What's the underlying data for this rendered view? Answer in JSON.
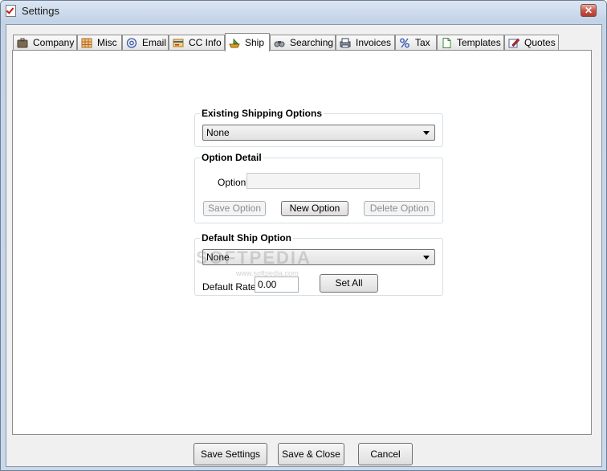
{
  "window": {
    "title": "Settings"
  },
  "tabs": [
    {
      "label": "Company",
      "icon": "briefcase-icon"
    },
    {
      "label": "Misc",
      "icon": "grid-icon"
    },
    {
      "label": "Email",
      "icon": "at-sign-icon"
    },
    {
      "label": "CC Info",
      "icon": "credit-card-icon"
    },
    {
      "label": "Ship",
      "icon": "ship-icon",
      "active": true
    },
    {
      "label": "Searching",
      "icon": "binoculars-icon"
    },
    {
      "label": "Invoices",
      "icon": "printer-icon"
    },
    {
      "label": "Tax",
      "icon": "percent-icon"
    },
    {
      "label": "Templates",
      "icon": "document-icon"
    },
    {
      "label": "Quotes",
      "icon": "note-pencil-icon"
    }
  ],
  "existing": {
    "title": "Existing Shipping Options",
    "selected": "None"
  },
  "detail": {
    "title": "Option Detail",
    "option_label": "Option",
    "option_value": "",
    "save_label": "Save Option",
    "new_label": "New Option",
    "delete_label": "Delete Option"
  },
  "default_ship": {
    "title": "Default Ship Option",
    "selected": "None",
    "rate_label": "Default Rate",
    "rate_value": "0.00",
    "set_all_label": "Set All"
  },
  "watermark": {
    "text": "SOFTPEDIA",
    "sub": "www.softpedia.com"
  },
  "footer": {
    "save_settings": "Save Settings",
    "save_close": "Save & Close",
    "cancel": "Cancel"
  },
  "colors": {
    "accent_ship": "#e0a020",
    "close_red": "#c8574a"
  }
}
